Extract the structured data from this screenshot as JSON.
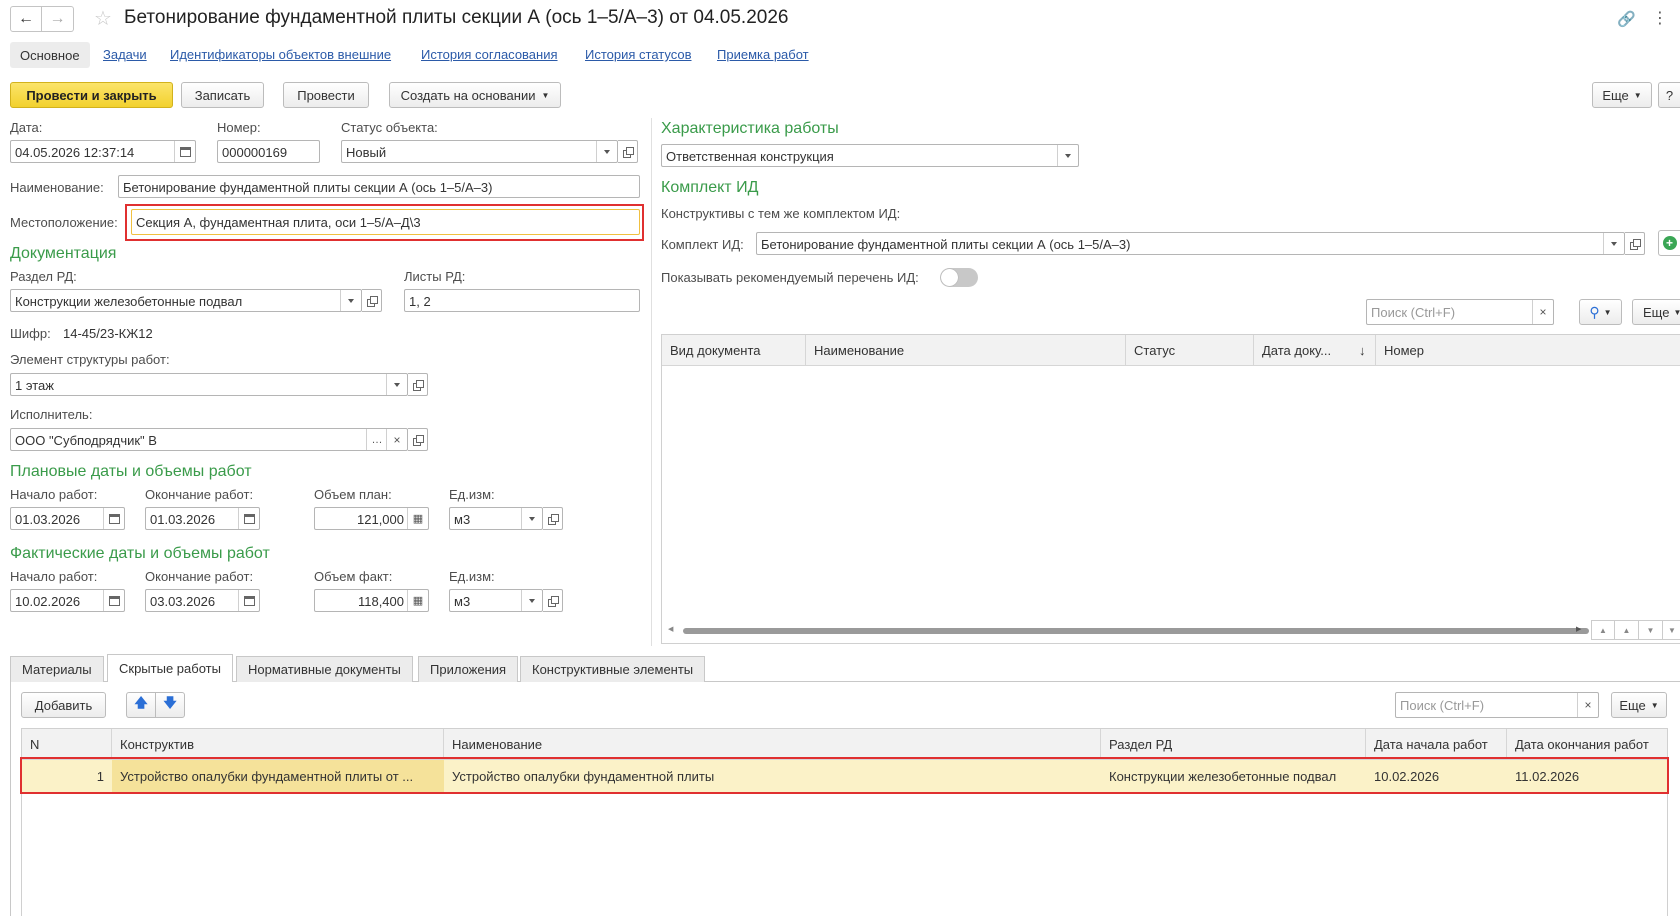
{
  "window": {
    "title": "Бетонирование фундаментной плиты секции А (ось 1–5/А–3) от 04.05.2026"
  },
  "nav_tabs": [
    "Основное",
    "Задачи",
    "Идентификаторы объектов внешние",
    "История согласования",
    "История статусов",
    "Приемка работ"
  ],
  "toolbar": {
    "post_close": "Провести и закрыть",
    "save": "Записать",
    "post": "Провести",
    "create_based": "Создать на основании",
    "more": "Еще",
    "help": "?"
  },
  "form": {
    "date_label": "Дата:",
    "date_value": "04.05.2026 12:37:14",
    "number_label": "Номер:",
    "number_value": "000000169",
    "status_label": "Статус объекта:",
    "status_value": "Новый",
    "name_label": "Наименование:",
    "name_value": "Бетонирование фундаментной плиты секции А (ось 1–5/А–3)",
    "location_label": "Местоположение:",
    "location_value": "Секция А, фундаментная плита, оси 1–5/А–Д\\3"
  },
  "documentation": {
    "title": "Документация",
    "section_label": "Раздел РД:",
    "section_value": "Конструкции железобетонные подвал",
    "sheets_label": "Листы РД:",
    "sheets_value": "1, 2",
    "cipher_label": "Шифр:",
    "cipher_value": "14-45/23-КЖ12",
    "element_label": "Элемент структуры работ:",
    "element_value": "1 этаж",
    "executor_label": "Исполнитель:",
    "executor_value": "ООО \"Субподрядчик\" В"
  },
  "planned": {
    "title": "Плановые даты и объемы работ",
    "start_label": "Начало работ:",
    "start_value": "01.03.2026",
    "end_label": "Окончание работ:",
    "end_value": "01.03.2026",
    "volume_label": "Объем план:",
    "volume_value": "121,000",
    "unit_label": "Ед.изм:",
    "unit_value": "м3"
  },
  "actual": {
    "title": "Фактические даты и объемы работ",
    "start_label": "Начало работ:",
    "start_value": "10.02.2026",
    "end_label": "Окончание работ:",
    "end_value": "03.03.2026",
    "volume_label": "Объем факт:",
    "volume_value": "118,400",
    "unit_label": "Ед.изм:",
    "unit_value": "м3"
  },
  "work_char": {
    "title": "Характеристика работы",
    "value": "Ответственная конструкция"
  },
  "id_set": {
    "title": "Комплект ИД",
    "subtitle": "Конструктивы с тем же комплектом ИД:",
    "label": "Комплект ИД:",
    "value": "Бетонирование фундаментной плиты секции А (ось 1–5/А–3)",
    "show_recommended_label": "Показывать рекомендуемый перечень ИД:",
    "search_placeholder": "Поиск (Ctrl+F)",
    "more": "Еще",
    "columns": [
      "Вид документа",
      "Наименование",
      "Статус",
      "Дата доку...",
      "↓",
      "Номер"
    ]
  },
  "bottom_tabs": [
    "Материалы",
    "Скрытые работы",
    "Нормативные документы",
    "Приложения",
    "Конструктивные элементы"
  ],
  "bottom": {
    "add": "Добавить",
    "search_placeholder": "Поиск (Ctrl+F)",
    "more": "Еще",
    "columns": [
      "N",
      "Конструктив",
      "Наименование",
      "Раздел РД",
      "Дата начала работ",
      "Дата окончания работ"
    ],
    "rows": [
      {
        "n": "1",
        "construct": "Устройство опалубки фундаментной плиты от ...",
        "name": "Устройство опалубки фундаментной плиты",
        "section": "Конструкции железобетонные подвал",
        "start": "10.02.2026",
        "end": "11.02.2026"
      }
    ]
  },
  "colors": {
    "accent_yellow": "#f5d94a",
    "section_green": "#3a9b4a",
    "link_blue": "#2b5aa8",
    "highlight_red": "#e03030",
    "row_highlight": "#fbf2c8"
  }
}
